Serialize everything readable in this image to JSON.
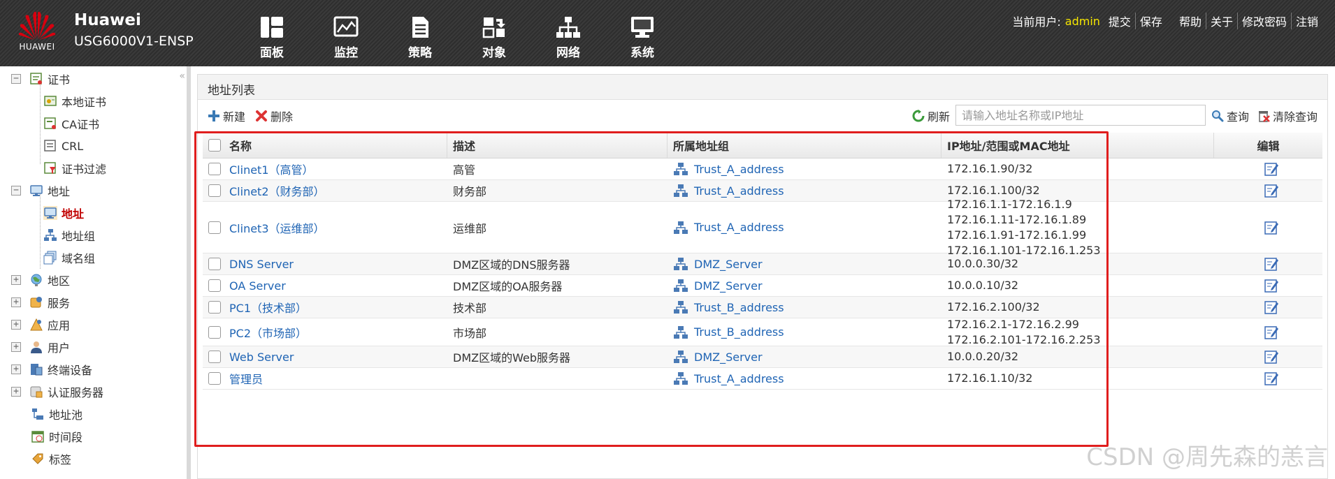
{
  "header": {
    "logo_text": "HUAWEI",
    "brand_name": "Huawei",
    "model": "USG6000V1-ENSP",
    "nav": [
      {
        "label": "面板",
        "icon": "dashboard-icon"
      },
      {
        "label": "监控",
        "icon": "monitor-icon"
      },
      {
        "label": "策略",
        "icon": "policy-icon"
      },
      {
        "label": "对象",
        "icon": "object-icon"
      },
      {
        "label": "网络",
        "icon": "network-icon"
      },
      {
        "label": "系统",
        "icon": "system-icon"
      }
    ],
    "current_user_label": "当前用户:",
    "current_user": "admin",
    "links": [
      "提交",
      "保存",
      "帮助",
      "关于",
      "修改密码",
      "注销"
    ]
  },
  "sidebar": {
    "collapse_glyph": "«",
    "items": [
      {
        "label": "证书",
        "icon": "certificate-icon",
        "expander": "−"
      },
      {
        "label": "本地证书",
        "icon": "local-certificate-icon"
      },
      {
        "label": "CA证书",
        "icon": "ca-certificate-icon"
      },
      {
        "label": "CRL",
        "icon": "crl-icon"
      },
      {
        "label": "证书过滤",
        "icon": "certificate-filter-icon"
      },
      {
        "label": "地址",
        "icon": "address-folder-icon",
        "expander": "−"
      },
      {
        "label": "地址",
        "icon": "address-icon",
        "active": true
      },
      {
        "label": "地址组",
        "icon": "address-group-icon"
      },
      {
        "label": "域名组",
        "icon": "domain-group-icon"
      },
      {
        "label": "地区",
        "icon": "region-icon",
        "expander": "+"
      },
      {
        "label": "服务",
        "icon": "service-icon",
        "expander": "+"
      },
      {
        "label": "应用",
        "icon": "application-icon",
        "expander": "+"
      },
      {
        "label": "用户",
        "icon": "user-icon",
        "expander": "+"
      },
      {
        "label": "终端设备",
        "icon": "terminal-device-icon",
        "expander": "+"
      },
      {
        "label": "认证服务器",
        "icon": "auth-server-icon",
        "expander": "+"
      },
      {
        "label": "地址池",
        "icon": "address-pool-icon"
      },
      {
        "label": "时间段",
        "icon": "time-range-icon"
      },
      {
        "label": "标签",
        "icon": "tag-icon"
      }
    ]
  },
  "panel": {
    "title": "地址列表",
    "toolbar": {
      "new_label": "新建",
      "delete_label": "删除",
      "refresh_label": "刷新",
      "search_placeholder": "请输入地址名称或IP地址",
      "search_value": "",
      "query_label": "查询",
      "clear_label": "清除查询"
    },
    "columns": [
      "名称",
      "描述",
      "所属地址组",
      "IP地址/范围或MAC地址",
      "编辑"
    ],
    "rows": [
      {
        "name": "Clinet1（高管）",
        "desc": "高管",
        "group": "Trust_A_address",
        "ips": [
          "172.16.1.90/32"
        ]
      },
      {
        "name": "Clinet2（财务部）",
        "desc": "财务部",
        "group": "Trust_A_address",
        "ips": [
          "172.16.1.100/32"
        ]
      },
      {
        "name": "Clinet3（运维部）",
        "desc": "运维部",
        "group": "Trust_A_address",
        "ips": [
          "172.16.1.1-172.16.1.9",
          "172.16.1.11-172.16.1.89",
          "172.16.1.91-172.16.1.99",
          "172.16.1.101-172.16.1.253"
        ]
      },
      {
        "name": "DNS Server",
        "desc": "DMZ区域的DNS服务器",
        "group": "DMZ_Server",
        "ips": [
          "10.0.0.30/32"
        ]
      },
      {
        "name": "OA Server",
        "desc": "DMZ区域的OA服务器",
        "group": "DMZ_Server",
        "ips": [
          "10.0.0.10/32"
        ]
      },
      {
        "name": "PC1（技术部）",
        "desc": "技术部",
        "group": "Trust_B_address",
        "ips": [
          "172.16.2.100/32"
        ]
      },
      {
        "name": "PC2（市场部）",
        "desc": "市场部",
        "group": "Trust_B_address",
        "ips": [
          "172.16.2.1-172.16.2.99",
          "172.16.2.101-172.16.2.253"
        ]
      },
      {
        "name": "Web Server",
        "desc": "DMZ区域的Web服务器",
        "group": "DMZ_Server",
        "ips": [
          "10.0.0.20/32"
        ]
      },
      {
        "name": "管理员",
        "desc": "",
        "group": "Trust_A_address",
        "ips": [
          "172.16.1.10/32"
        ]
      }
    ]
  },
  "watermark": "CSDN @周先森的恙言",
  "colors": {
    "link": "#1f64b4",
    "highlight": "#e01e1e",
    "active_nav": "#c00000",
    "user_name": "#f6e600",
    "logo": "#d7000f"
  }
}
